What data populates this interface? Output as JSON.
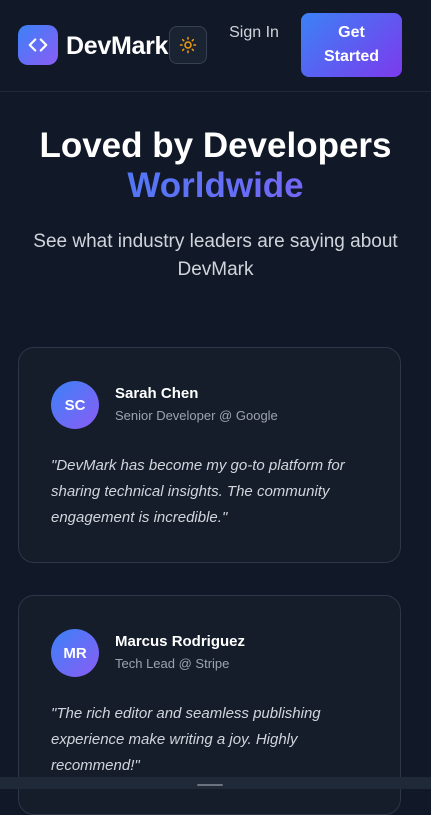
{
  "header": {
    "brand": "DevMark",
    "logo_icon": "code-brackets-icon",
    "theme_icon": "sun-icon",
    "signin_label": "Sign In",
    "cta_label": "Get Started"
  },
  "hero": {
    "title_line1": "Loved by Developers",
    "title_line2": "Worldwide",
    "subtitle": "See what industry leaders are saying about DevMark"
  },
  "testimonials": [
    {
      "initials": "SC",
      "name": "Sarah Chen",
      "role": "Senior Developer @ Google",
      "quote": "\"DevMark has become my go-to platform for sharing technical insights. The community engagement is incredible.\""
    },
    {
      "initials": "MR",
      "name": "Marcus Rodriguez",
      "role": "Tech Lead @ Stripe",
      "quote": "\"The rich editor and seamless publishing experience make writing a joy. Highly recommend!\""
    }
  ],
  "colors": {
    "background": "#111827",
    "card": "#151d2b",
    "accent_start": "#3b82f6",
    "accent_end": "#8b5cf6",
    "sun": "#f59e0b"
  }
}
